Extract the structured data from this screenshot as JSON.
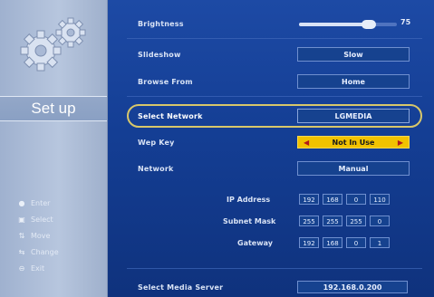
{
  "sidebar": {
    "section_title": "Set up",
    "gear_icon": "gears-icon",
    "legend": [
      {
        "icon": "dot-icon",
        "label": "Enter"
      },
      {
        "icon": "square-icon",
        "label": "Select"
      },
      {
        "icon": "arrow-up-down-icon",
        "label": "Move"
      },
      {
        "icon": "arrow-left-right-icon",
        "label": "Change"
      },
      {
        "icon": "exit-icon",
        "label": "Exit"
      }
    ]
  },
  "settings": {
    "brightness": {
      "label": "Brightness",
      "value": "75",
      "level": 0.75
    },
    "slideshow": {
      "label": "Slideshow",
      "value": "Slow"
    },
    "browse_from": {
      "label": "Browse From",
      "value": "Home"
    },
    "select_network": {
      "label": "Select Network",
      "value": "LGMEDIA"
    },
    "wep_key": {
      "label": "Wep Key",
      "value": "Not In Use"
    },
    "network": {
      "label": "Network",
      "value": "Manual"
    },
    "ip_address": {
      "label": "IP Address",
      "octets": [
        "192",
        "168",
        "0",
        "110"
      ]
    },
    "subnet_mask": {
      "label": "Subnet Mask",
      "octets": [
        "255",
        "255",
        "255",
        "0"
      ]
    },
    "gateway": {
      "label": "Gateway",
      "octets": [
        "192",
        "168",
        "0",
        "1"
      ]
    },
    "media_server": {
      "label": "Select Media Server",
      "value": "192.168.0.200"
    }
  },
  "colors": {
    "background": "#143e94",
    "left_panel": "#b7c6de",
    "highlight": "#d8c76a",
    "wep_bg": "#f2c200"
  }
}
